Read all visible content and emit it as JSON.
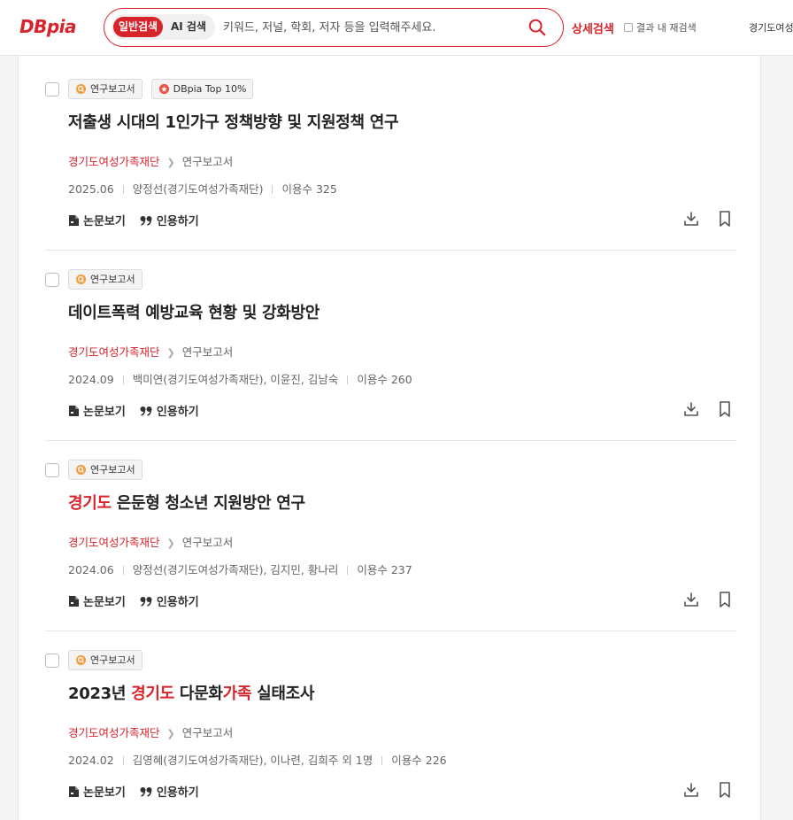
{
  "header": {
    "logo_text": "DBpia",
    "search": {
      "tab_general": "일반검색",
      "tab_ai": "AI 검색",
      "placeholder": "키워드, 저널, 학회, 저자 등을 입력해주세요."
    },
    "advanced_search": "상세검색",
    "search_in_results": "결과 내 재검색",
    "org_name_truncated": "경기도여성"
  },
  "results": [
    {
      "badges": [
        "연구보고서",
        "DBpia Top 10%"
      ],
      "title_parts": [
        {
          "text": "저출생 시대의 1인가구 정책방향 및 지원정책 연구",
          "hl": false
        }
      ],
      "publisher": "경기도여성가족재단",
      "pub_type": "연구보고서",
      "date": "2025.06",
      "authors": "양정선(경기도여성가족재단)",
      "usage": "이용수 325"
    },
    {
      "badges": [
        "연구보고서"
      ],
      "title_parts": [
        {
          "text": "데이트폭력 예방교육 현황 및 강화방안",
          "hl": false
        }
      ],
      "publisher": "경기도여성가족재단",
      "pub_type": "연구보고서",
      "date": "2024.09",
      "authors": "백미연(경기도여성가족재단), 이윤진, 김남숙",
      "usage": "이용수 260"
    },
    {
      "badges": [
        "연구보고서"
      ],
      "title_parts": [
        {
          "text": "경기도",
          "hl": true
        },
        {
          "text": " 은둔형 청소년 지원방안 연구",
          "hl": false
        }
      ],
      "publisher": "경기도여성가족재단",
      "pub_type": "연구보고서",
      "date": "2024.06",
      "authors": "양정선(경기도여성가족재단), 김지민, 황나리",
      "usage": "이용수 237"
    },
    {
      "badges": [
        "연구보고서"
      ],
      "title_parts": [
        {
          "text": "2023년 ",
          "hl": false
        },
        {
          "text": "경기도",
          "hl": true
        },
        {
          "text": " 다문화",
          "hl": false
        },
        {
          "text": "가족",
          "hl": true
        },
        {
          "text": " 실태조사",
          "hl": false
        }
      ],
      "publisher": "경기도여성가족재단",
      "pub_type": "연구보고서",
      "date": "2024.02",
      "authors": "김영혜(경기도여성가족재단), 이나련, 김희주 외 1명",
      "usage": "이용수 226"
    }
  ],
  "actions": {
    "view_paper": "논문보기",
    "cite": "인용하기"
  },
  "colors": {
    "accent": "#d8232a"
  }
}
